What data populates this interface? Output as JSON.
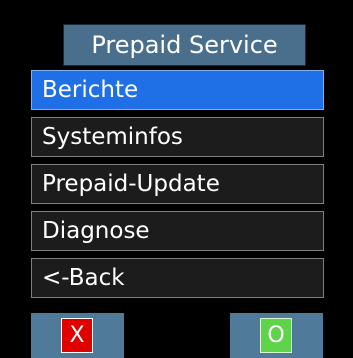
{
  "screen": {
    "title": "Prepaid Service"
  },
  "menu": {
    "items": [
      {
        "label": "Berichte",
        "selected": true
      },
      {
        "label": "Systeminfos",
        "selected": false
      },
      {
        "label": "Prepaid-Update",
        "selected": false
      },
      {
        "label": "Diagnose",
        "selected": false
      },
      {
        "label": "<-Back",
        "selected": false
      }
    ]
  },
  "softkeys": {
    "cancel_label": "X",
    "ok_label": "O"
  },
  "colors": {
    "background": "#000000",
    "title_bg": "#4a6f8c",
    "selected_bg": "#1f6fe6",
    "item_bg": "#1c1c1c",
    "softkey_bg": "#4f7a9a",
    "cancel": "#e00000",
    "ok": "#5fd34a"
  }
}
